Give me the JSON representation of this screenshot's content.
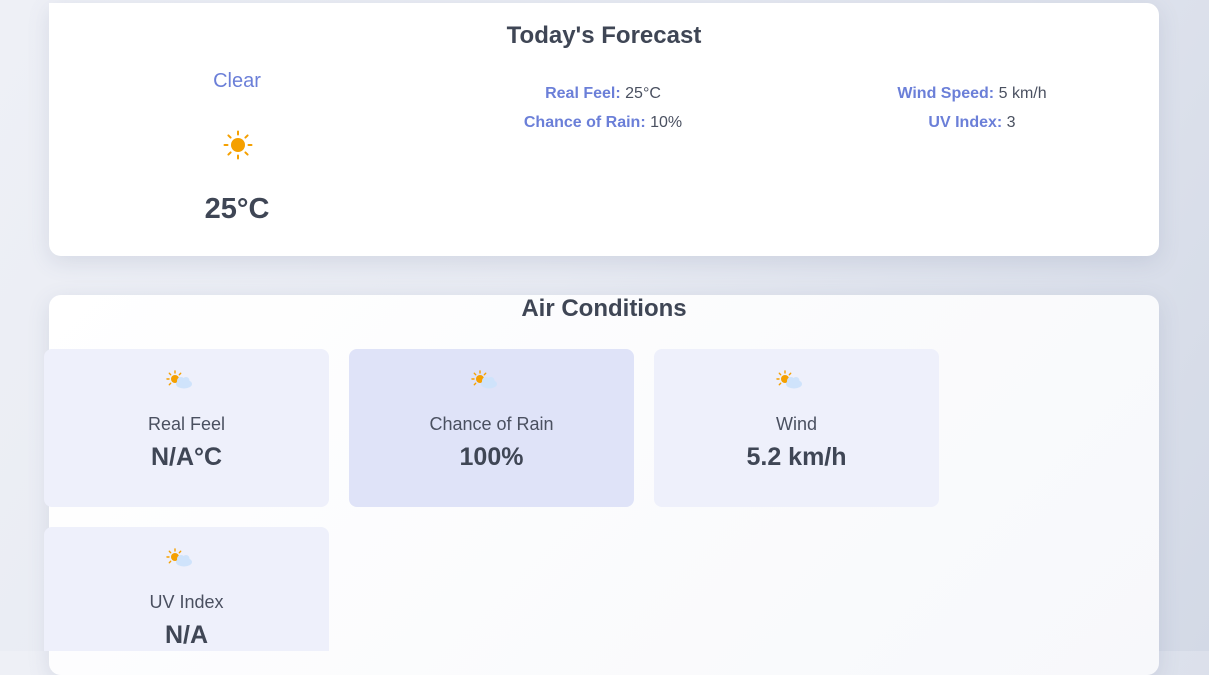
{
  "forecast": {
    "title": "Today's Forecast",
    "condition": "Clear",
    "condition_icon": "sun-icon",
    "temperature": "25°C",
    "details": {
      "real_feel": {
        "label": "Real Feel:",
        "value": "25°C"
      },
      "chance_of_rain": {
        "label": "Chance of Rain:",
        "value": "10%"
      },
      "wind_speed": {
        "label": "Wind Speed:",
        "value": "5 km/h"
      },
      "uv_index": {
        "label": "UV Index:",
        "value": "3"
      }
    }
  },
  "air_conditions": {
    "title": "Air Conditions",
    "tiles": [
      {
        "label": "Real Feel",
        "value": "N/A°C",
        "icon": "sun-behind-cloud-icon"
      },
      {
        "label": "Chance of Rain",
        "value": "100%",
        "icon": "sun-behind-cloud-icon"
      },
      {
        "label": "Wind",
        "value": "5.2 km/h",
        "icon": "sun-behind-cloud-icon"
      },
      {
        "label": "UV Index",
        "value": "N/A",
        "icon": "sun-behind-cloud-icon"
      }
    ]
  },
  "colors": {
    "accent": "#6b7fd8",
    "sun": "#f5a000",
    "tile": "#eef0fb",
    "tile_active": "#dfe3f8"
  }
}
